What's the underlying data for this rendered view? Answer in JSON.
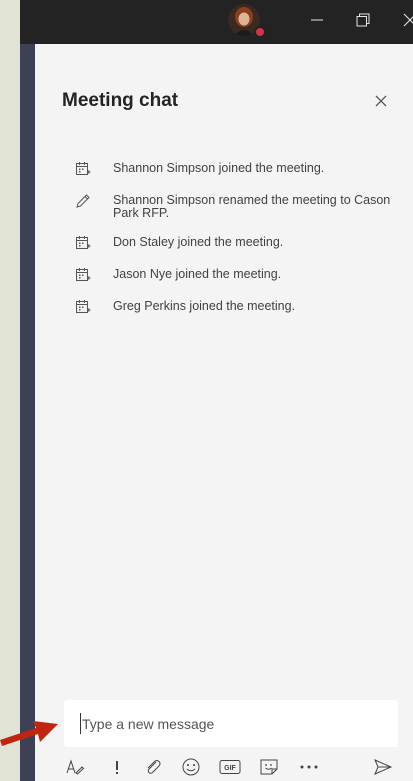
{
  "window": {
    "status_color": "#d7324a"
  },
  "chat": {
    "title": "Meeting chat",
    "events": [
      {
        "icon": "meeting-join-icon",
        "text": "Shannon Simpson joined the meeting."
      },
      {
        "icon": "pencil-icon",
        "text": "Shannon Simpson renamed the meeting to Cason Park RFP."
      },
      {
        "icon": "meeting-join-icon",
        "text": "Don Staley joined the meeting."
      },
      {
        "icon": "meeting-join-icon",
        "text": "Jason Nye joined the meeting."
      },
      {
        "icon": "meeting-join-icon",
        "text": "Greg Perkins joined the meeting."
      }
    ]
  },
  "compose": {
    "placeholder": "Type a new message"
  },
  "toolbar": {
    "buttons": [
      "format-icon",
      "important-icon",
      "attach-icon",
      "emoji-icon",
      "gif-icon",
      "sticker-icon",
      "more-icon",
      "send-icon"
    ],
    "gif_label": "GIF"
  },
  "annotation": {
    "arrow_color": "#c0250f"
  }
}
